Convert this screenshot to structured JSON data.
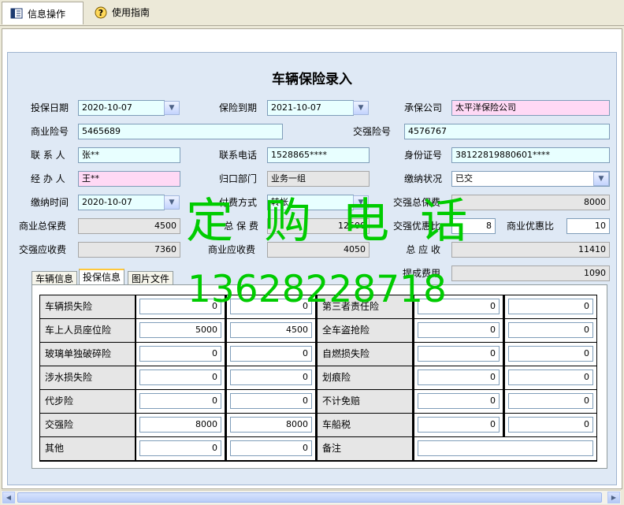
{
  "tabs": [
    {
      "label": "信息操作",
      "icon": "form-icon"
    },
    {
      "label": "使用指南",
      "icon": "help-icon"
    }
  ],
  "title": "车辆保险录入",
  "form": {
    "toubao_date": {
      "label": "投保日期",
      "value": "2020-10-07"
    },
    "baoxian_daoqi": {
      "label": "保险到期",
      "value": "2021-10-07"
    },
    "chengbao": {
      "label": "承保公司",
      "value": "太平洋保险公司"
    },
    "shangye_no": {
      "label": "商业险号",
      "value": "5465689"
    },
    "jiaoqiang_no": {
      "label": "交强险号",
      "value": "4576767"
    },
    "lianxiren": {
      "label": "联 系 人",
      "value": "张**"
    },
    "phone": {
      "label": "联系电话",
      "value": "1528865****"
    },
    "idcard": {
      "label": "身份证号",
      "value": "38122819880601****"
    },
    "jingban": {
      "label": "经 办 人",
      "value": "王**"
    },
    "guikou": {
      "label": "归口部门",
      "value": "业务一组"
    },
    "jiaona_status": {
      "label": "缴纳状况",
      "value": "已交"
    },
    "jiaona_time": {
      "label": "缴纳时间",
      "value": "2020-10-07"
    },
    "fufei": {
      "label": "付费方式",
      "value": "转帐"
    },
    "jq_total": {
      "label": "交强总保费",
      "value": "8000"
    },
    "sy_total": {
      "label": "商业总保费",
      "value": "4500"
    },
    "zong_baofei": {
      "label": "总 保 费",
      "value": "12500"
    },
    "jq_discount": {
      "label": "交强优惠比",
      "value": "8"
    },
    "sy_discount": {
      "label": "商业优惠比",
      "value": "10"
    },
    "jq_due": {
      "label": "交强应收费",
      "value": "7360"
    },
    "sy_due": {
      "label": "商业应收费",
      "value": "4050"
    },
    "total_due": {
      "label": "总 应 收",
      "value": "11410"
    },
    "commission": {
      "label": "提成费用",
      "value": "1090"
    }
  },
  "subtabs": [
    "车辆信息",
    "投保信息",
    "图片文件"
  ],
  "grid": {
    "left": [
      {
        "label": "车辆损失险",
        "a": "0",
        "b": "0"
      },
      {
        "label": "车上人员座位险",
        "a": "5000",
        "b": "4500"
      },
      {
        "label": "玻璃单独破碎险",
        "a": "0",
        "b": "0"
      },
      {
        "label": "涉水损失险",
        "a": "0",
        "b": "0"
      },
      {
        "label": "代步险",
        "a": "0",
        "b": "0"
      },
      {
        "label": "交强险",
        "a": "8000",
        "b": "8000"
      },
      {
        "label": "其他",
        "a": "0",
        "b": "0"
      }
    ],
    "right": [
      {
        "label": "第三者责任险",
        "a": "0",
        "b": "0"
      },
      {
        "label": "全车盗抢险",
        "a": "0",
        "b": "0"
      },
      {
        "label": "自燃损失险",
        "a": "0",
        "b": "0"
      },
      {
        "label": "划痕险",
        "a": "0",
        "b": "0"
      },
      {
        "label": "不计免赔",
        "a": "0",
        "b": "0"
      },
      {
        "label": "车船税",
        "a": "0",
        "b": "0"
      },
      {
        "label": "备注",
        "a": ""
      }
    ]
  },
  "watermark": {
    "line1": "定 购 电 话",
    "line2": "13628228718",
    "color": "#00cc00"
  }
}
